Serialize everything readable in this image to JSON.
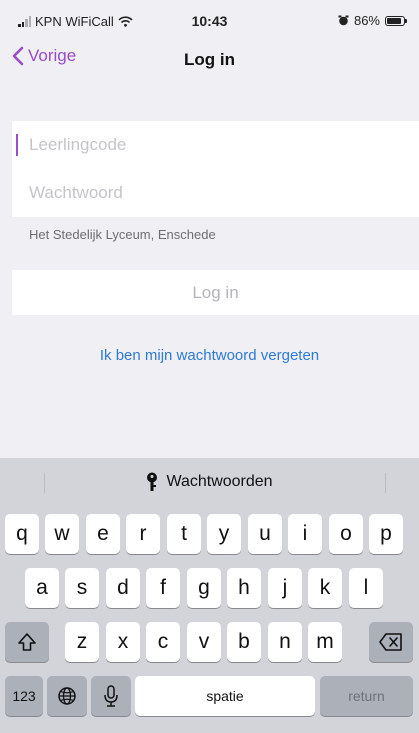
{
  "status_bar": {
    "carrier": "KPN WiFiCall",
    "time": "10:43",
    "battery": "86%",
    "battery_level": 0.86
  },
  "nav": {
    "back_label": "Vorige",
    "title": "Log in"
  },
  "form": {
    "username_placeholder": "Leerlingcode",
    "username_value": "",
    "password_placeholder": "Wachtwoord",
    "password_value": "",
    "school": "Het Stedelijk Lyceum, Enschede",
    "login_label": "Log in",
    "forgot_label": "Ik ben mijn wachtwoord vergeten"
  },
  "keyboard": {
    "passwords_label": "Wachtwoorden",
    "row1": [
      "q",
      "w",
      "e",
      "r",
      "t",
      "y",
      "u",
      "i",
      "o",
      "p"
    ],
    "row2": [
      "a",
      "s",
      "d",
      "f",
      "g",
      "h",
      "j",
      "k",
      "l"
    ],
    "row3": [
      "z",
      "x",
      "c",
      "v",
      "b",
      "n",
      "m"
    ],
    "numbers_label": "123",
    "space_label": "spatie",
    "return_label": "return"
  },
  "colors": {
    "accent": "#9a4dc5",
    "link": "#2d7ad6",
    "background": "#f0f0f4",
    "keyboard_background": "#d2d4da"
  },
  "icons": {
    "back": "chevron-left-icon",
    "wifi": "wifi-icon",
    "alarm": "alarm-icon",
    "battery": "battery-icon",
    "key": "key-icon",
    "shift": "shift-icon",
    "backspace": "backspace-icon",
    "globe": "globe-icon",
    "mic": "microphone-icon"
  }
}
